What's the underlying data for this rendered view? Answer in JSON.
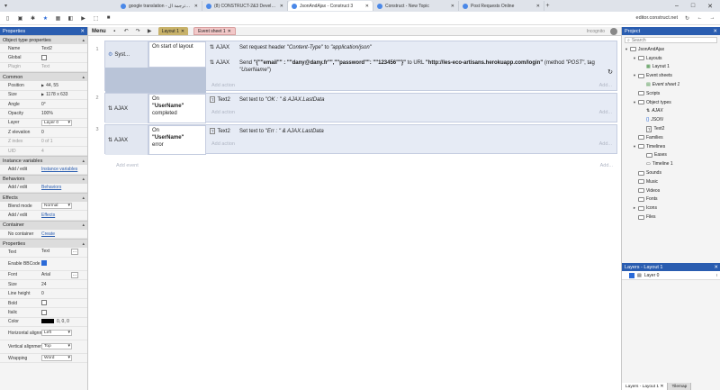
{
  "browser": {
    "tabs": [
      {
        "label": "google translation - ترجمة ال- Goo"
      },
      {
        "label": "(8) CONSTRUCT-2&3 Developers"
      },
      {
        "label": "JsonAndAjax - Construct 3",
        "active": true
      },
      {
        "label": "Construct - New Topic"
      },
      {
        "label": "Post Requests Online"
      }
    ],
    "url": "editor.construct.net"
  },
  "properties": {
    "title": "Properties",
    "sections": [
      {
        "name": "Object type properties",
        "rows": [
          {
            "k": "Name",
            "v": "Text2",
            "type": "text"
          },
          {
            "k": "Global",
            "type": "check",
            "checked": false
          },
          {
            "k": "Plugin",
            "v": "Text",
            "type": "text",
            "dim": true
          }
        ]
      },
      {
        "name": "Common",
        "rows": [
          {
            "k": "Position",
            "v": "44, 55",
            "type": "text"
          },
          {
            "k": "Size",
            "v": "1178 x 633",
            "type": "text"
          },
          {
            "k": "Angle",
            "v": "0°",
            "type": "text"
          },
          {
            "k": "Opacity",
            "v": "100%",
            "type": "text"
          },
          {
            "k": "Layer",
            "v": "Layer 0",
            "type": "select"
          },
          {
            "k": "Z elevation",
            "v": "0",
            "type": "text"
          },
          {
            "k": "Z index",
            "v": "0 of 1",
            "type": "text",
            "dim": true
          },
          {
            "k": "UID",
            "v": "4",
            "type": "text",
            "dim": true
          }
        ]
      },
      {
        "name": "Instance variables",
        "rows": [
          {
            "k": "Add / edit",
            "v": "Instance variables",
            "type": "link"
          }
        ]
      },
      {
        "name": "Behaviors",
        "rows": [
          {
            "k": "Add / edit",
            "v": "Behaviors",
            "type": "link"
          }
        ]
      },
      {
        "name": "Effects",
        "rows": [
          {
            "k": "Blend mode",
            "v": "Normal",
            "type": "select"
          },
          {
            "k": "Add / edit",
            "v": "Effects",
            "type": "link"
          }
        ]
      },
      {
        "name": "Container",
        "rows": [
          {
            "k": "No container",
            "v": "Create",
            "type": "link"
          }
        ]
      },
      {
        "name": "Properties",
        "rows": [
          {
            "k": "Text",
            "v": "Text",
            "type": "dots"
          },
          {
            "k": "Enable BBCode",
            "type": "check",
            "checked": true
          },
          {
            "k": "Font",
            "v": "Arial",
            "type": "dots"
          },
          {
            "k": "Size",
            "v": "24",
            "type": "text"
          },
          {
            "k": "Line height",
            "v": "0",
            "type": "text"
          },
          {
            "k": "Bold",
            "type": "check",
            "checked": false
          },
          {
            "k": "Italic",
            "type": "check",
            "checked": false
          },
          {
            "k": "Color",
            "v": "0, 0, 0",
            "type": "color"
          },
          {
            "k": "Horizontal alignment",
            "v": "Left",
            "type": "select"
          },
          {
            "k": "Vertical alignment",
            "v": "Top",
            "type": "select"
          },
          {
            "k": "Wrapping",
            "v": "Word",
            "type": "select"
          }
        ]
      }
    ]
  },
  "toolbar": {
    "menu": "Menu",
    "tab_layout": "Layout 1",
    "tab_sheet": "Event sheet 1",
    "incognito": "Incognito"
  },
  "events": [
    {
      "num": "1",
      "cond_obj": "Syst...",
      "cond": "On start of layout",
      "actions": [
        {
          "obj": "AJAX",
          "html": "Set request header <i>\"Content-Type\"</i> to <i>\"application/json\"</i>"
        },
        {
          "obj": "AJAX",
          "html": "Send <b>\"{\"\"email\"\" : \"\"dany@dany.fr\"\",\"\"password\"\": \"\"123456\"\"}\"</b> to URL <b>\"http://les-eco-artisans.herokuapp.com/login\"</b> (method <i>\"POST\"</i>, tag <i>\"UserName\"</i>)"
        }
      ]
    },
    {
      "num": "2",
      "cond_obj": "AJAX",
      "cond": "On \"UserName\" completed",
      "actions": [
        {
          "obj": "Text2",
          "html": "Set text to <i>\"OK : \" &amp; AJAX.LastData</i>"
        }
      ]
    },
    {
      "num": "3",
      "cond_obj": "AJAX",
      "cond": "On \"UserName\" error",
      "actions": [
        {
          "obj": "Text2",
          "html": "Set text to <i>\"Err : \" &amp; AJAX.LastData</i>"
        }
      ]
    }
  ],
  "labels": {
    "add_action": "Add action",
    "add_event": "Add event",
    "add_dots": "Add..."
  },
  "project": {
    "title": "Project",
    "search_placeholder": "Search",
    "tree": [
      {
        "d": 0,
        "t": "JsonAndAjax",
        "tw": "▾",
        "ic": "folder"
      },
      {
        "d": 1,
        "t": "Layouts",
        "tw": "▾",
        "ic": "folder"
      },
      {
        "d": 2,
        "t": "Layout 1",
        "tw": "",
        "ic": "layout"
      },
      {
        "d": 1,
        "t": "Event sheets",
        "tw": "▾",
        "ic": "folder"
      },
      {
        "d": 2,
        "t": "Event sheet 1",
        "tw": "",
        "ic": "sheet",
        "italic": true
      },
      {
        "d": 1,
        "t": "Scripts",
        "tw": "",
        "ic": "folder"
      },
      {
        "d": 1,
        "t": "Object types",
        "tw": "▾",
        "ic": "folder"
      },
      {
        "d": 2,
        "t": "AJAX",
        "tw": "",
        "ic": "ajax",
        "italic": true
      },
      {
        "d": 2,
        "t": "JSON",
        "tw": "",
        "ic": "json",
        "italic": true
      },
      {
        "d": 2,
        "t": "Text2",
        "tw": "",
        "ic": "text"
      },
      {
        "d": 1,
        "t": "Families",
        "tw": "",
        "ic": "folder"
      },
      {
        "d": 1,
        "t": "Timelines",
        "tw": "▾",
        "ic": "folder"
      },
      {
        "d": 2,
        "t": "Eases",
        "tw": "",
        "ic": "folder"
      },
      {
        "d": 2,
        "t": "Timeline 1",
        "tw": "",
        "ic": "timeline"
      },
      {
        "d": 1,
        "t": "Sounds",
        "tw": "",
        "ic": "folder"
      },
      {
        "d": 1,
        "t": "Music",
        "tw": "",
        "ic": "folder"
      },
      {
        "d": 1,
        "t": "Videos",
        "tw": "",
        "ic": "folder"
      },
      {
        "d": 1,
        "t": "Fonts",
        "tw": "",
        "ic": "folder"
      },
      {
        "d": 1,
        "t": "Icons",
        "tw": "▸",
        "ic": "folder"
      },
      {
        "d": 1,
        "t": "Files",
        "tw": "",
        "ic": "folder"
      }
    ]
  },
  "layers": {
    "title": "Layers - Layout 1",
    "layer": "Layer 0",
    "tab_layers": "Layers - Layout 1",
    "tab_tilemap": "Tilemap"
  }
}
